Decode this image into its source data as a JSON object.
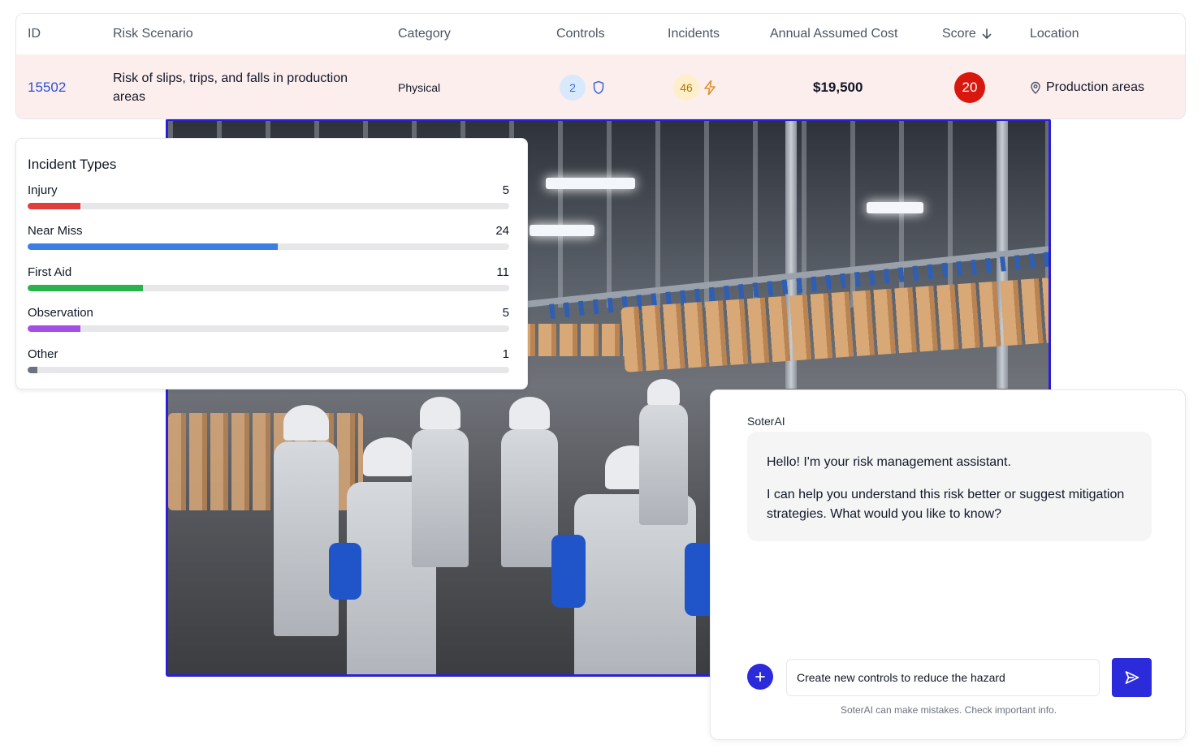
{
  "table": {
    "headers": {
      "id": "ID",
      "scenario": "Risk Scenario",
      "category": "Category",
      "controls": "Controls",
      "incidents": "Incidents",
      "cost": "Annual Assumed Cost",
      "score": "Score",
      "location": "Location"
    },
    "row": {
      "id": "15502",
      "scenario": "Risk of slips, trips, and falls in production areas",
      "category": "Physical",
      "controls": "2",
      "incidents": "46",
      "cost": "$19,500",
      "score": "20",
      "location": "Production areas"
    },
    "sort_icon": "arrow-down-icon",
    "colors": {
      "row_highlight": "#fdeeee",
      "id_link": "#2f4fd6",
      "score_badge": "#d8180f"
    }
  },
  "incident_types": {
    "title": "Incident Types",
    "items": [
      {
        "label": "Injury",
        "count": "5",
        "fraction": 0.11,
        "color": "#e23d3d"
      },
      {
        "label": "Near Miss",
        "count": "24",
        "fraction": 0.52,
        "color": "#3a7ee6"
      },
      {
        "label": "First Aid",
        "count": "11",
        "fraction": 0.24,
        "color": "#2bb24c"
      },
      {
        "label": "Observation",
        "count": "5",
        "fraction": 0.11,
        "color": "#a64de6"
      },
      {
        "label": "Other",
        "count": "1",
        "fraction": 0.02,
        "color": "#6b7280"
      }
    ]
  },
  "chat": {
    "title": "SoterAI",
    "message_line1": "Hello! I'm your risk management assistant.",
    "message_line2": "I can help you understand this risk better or suggest mitigation strategies. What would you like to know?",
    "input_value": "Create new controls to reduce the hazard",
    "disclaimer": "SoterAI can make mistakes. Check important info.",
    "accent": "#2b2bdb"
  }
}
